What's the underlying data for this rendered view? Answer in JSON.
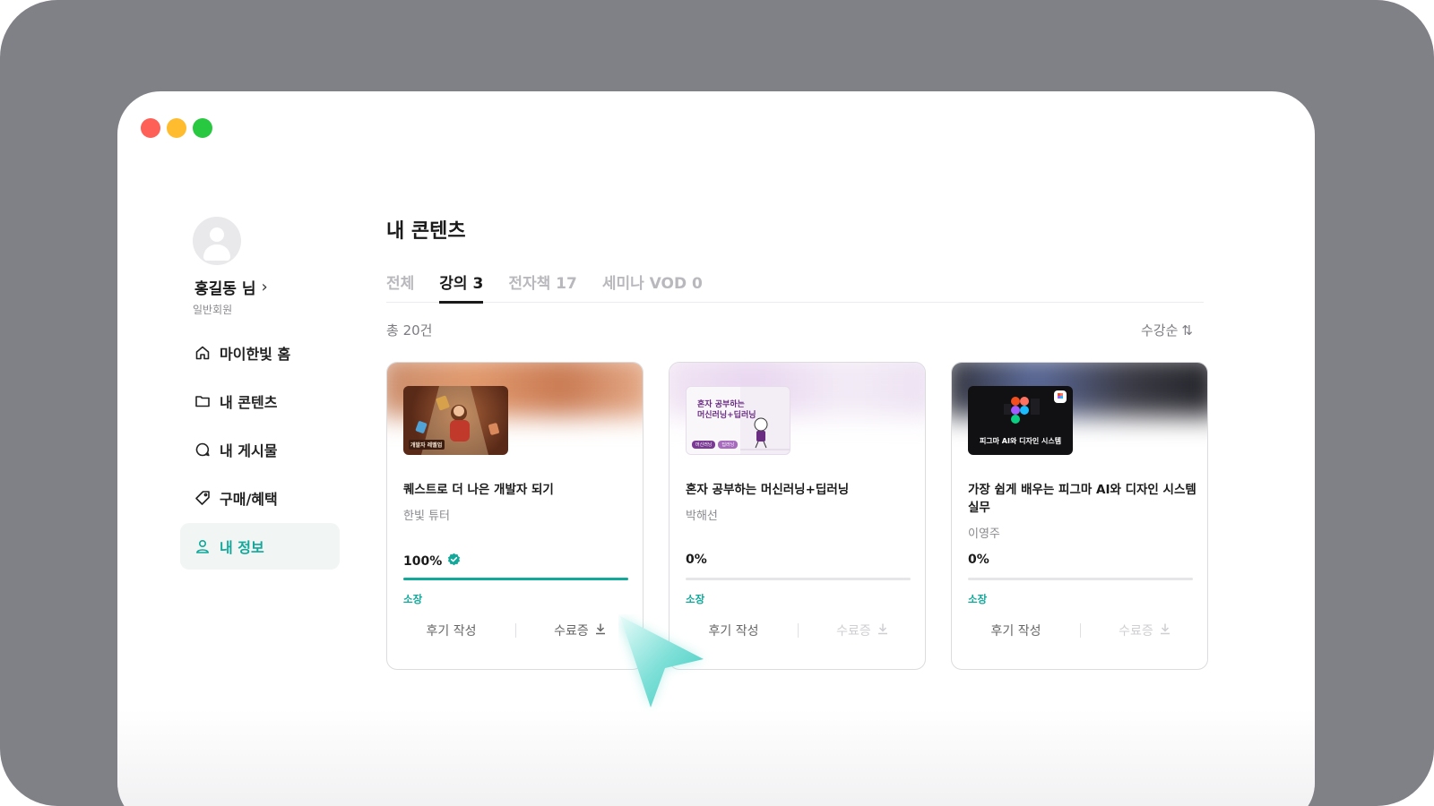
{
  "colors": {
    "frame": "#808087",
    "accent": "#12a89a",
    "traffic_red": "#fe5f57",
    "traffic_yellow": "#febc2e",
    "traffic_green": "#28c840"
  },
  "profile": {
    "name": "홍길동 님",
    "chevron": "›",
    "member_type": "일반회원"
  },
  "nav": [
    {
      "label": "마이한빛 홈",
      "icon": "home-icon"
    },
    {
      "label": "내 콘텐츠",
      "icon": "folder-icon"
    },
    {
      "label": "내 게시물",
      "icon": "chat-icon"
    },
    {
      "label": "구매/혜택",
      "icon": "tag-icon"
    },
    {
      "label": "내 정보",
      "icon": "user-icon",
      "active": true
    }
  ],
  "main": {
    "title": "내 콘텐츠",
    "tabs": [
      {
        "label": "전체"
      },
      {
        "label": "강의 3",
        "active": true
      },
      {
        "label": "전자책 17"
      },
      {
        "label": "세미나 VOD 0"
      }
    ],
    "total": "총 20건",
    "sort_label": "수강순",
    "sort_icon": "⇅"
  },
  "cards": [
    {
      "title": "퀘스트로 더 나은 개발자 되기",
      "author": "한빛 튜터",
      "progress_label": "100%",
      "progress": 1.0,
      "completed": true,
      "owned": "소장",
      "review": "후기 작성",
      "certificate": "수료증",
      "certificate_enabled": true,
      "thumb_caption": "개발자 레벨업"
    },
    {
      "title": "혼자 공부하는 머신러닝+딥러닝",
      "author": "박해선",
      "progress_label": "0%",
      "progress": 0,
      "completed": false,
      "owned": "소장",
      "review": "후기 작성",
      "certificate": "수료증",
      "certificate_enabled": false,
      "thumb_line1": "혼자 공부하는",
      "thumb_line2": "머신러닝+딥러닝",
      "thumb_tag1": "머신러닝",
      "thumb_tag2": "딥러닝"
    },
    {
      "title": "가장 쉽게 배우는 피그마 AI와 디자인 시스템 실무",
      "author": "이영주",
      "progress_label": "0%",
      "progress": 0,
      "completed": false,
      "owned": "소장",
      "review": "후기 작성",
      "certificate": "수료증",
      "certificate_enabled": false,
      "thumb_caption": "피그마 AI와 디자인 시스템"
    }
  ]
}
